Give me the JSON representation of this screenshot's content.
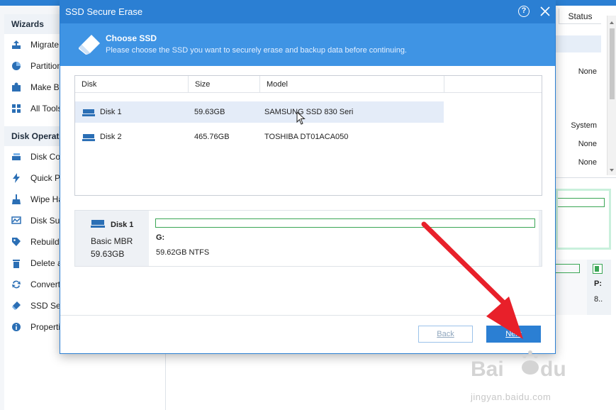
{
  "background": {
    "sidebar": {
      "sections": [
        {
          "title": "Wizards",
          "items": [
            {
              "label": "Migrate (",
              "icon": "migrate-icon"
            },
            {
              "label": "Partition",
              "icon": "partition-icon"
            },
            {
              "label": "Make Bo",
              "icon": "make-bootable-icon"
            },
            {
              "label": "All Tools",
              "icon": "all-tools-icon"
            }
          ]
        },
        {
          "title": "Disk Operati",
          "items": [
            {
              "label": "Disk Cop",
              "icon": "disk-copy-icon"
            },
            {
              "label": "Quick Pa",
              "icon": "quick-partition-icon"
            },
            {
              "label": "Wipe Ha",
              "icon": "wipe-icon"
            },
            {
              "label": "Disk Surf",
              "icon": "surface-test-icon"
            },
            {
              "label": "Rebuild I",
              "icon": "rebuild-mbr-icon"
            },
            {
              "label": "Delete a",
              "icon": "delete-icon"
            },
            {
              "label": "Convert",
              "icon": "convert-icon"
            },
            {
              "label": "SSD Secu",
              "icon": "ssd-secure-erase-icon"
            },
            {
              "label": "Propertie",
              "icon": "properties-icon"
            }
          ]
        }
      ]
    },
    "status_column": {
      "header": "Status",
      "values": [
        "None",
        "System",
        "None",
        "None"
      ]
    },
    "disk_panel": {
      "letter": "P:",
      "value": "8.."
    }
  },
  "dialog": {
    "title": "SSD Secure Erase",
    "help_label": "?",
    "header": {
      "title": "Choose SSD",
      "subtitle": "Please choose the SSD you want to securely erase and backup data before continuing."
    },
    "table": {
      "columns": [
        "Disk",
        "Size",
        "Model"
      ],
      "rows": [
        {
          "disk": "Disk 1",
          "size": "59.63GB",
          "model": "SAMSUNG SSD 830 Seri",
          "selected": true
        },
        {
          "disk": "Disk 2",
          "size": "465.76GB",
          "model": "TOSHIBA DT01ACA050",
          "selected": false
        }
      ]
    },
    "disk_map": {
      "name": "Disk 1",
      "type": "Basic MBR",
      "size": "59.63GB",
      "partition_letter": "G:",
      "partition_info": "59.62GB NTFS"
    },
    "buttons": {
      "back": "Back",
      "next": "Next"
    }
  },
  "watermark": {
    "url": "jingyan.baidu.com"
  },
  "colors": {
    "accent": "#2b7fd3",
    "header_band": "#3f94e4",
    "selected_row": "#e4ecf8",
    "partition_bar": "#3aa655",
    "annotation_arrow": "#e8202a"
  }
}
